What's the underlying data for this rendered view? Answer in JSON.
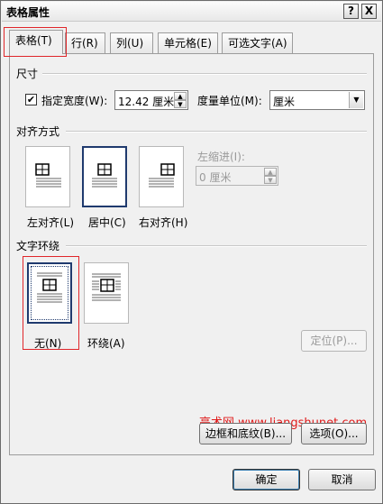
{
  "window": {
    "title": "表格属性",
    "help_label": "?",
    "close_label": "X"
  },
  "tabs": [
    {
      "label": "表格(T)"
    },
    {
      "label": "行(R)"
    },
    {
      "label": "列(U)"
    },
    {
      "label": "单元格(E)"
    },
    {
      "label": "可选文字(A)"
    }
  ],
  "size": {
    "group_title": "尺寸",
    "preferred_width_checked": true,
    "preferred_width_label": "指定宽度(W):",
    "width_value": "12.42 厘米",
    "measure_label": "度量单位(M):",
    "measure_value": "厘米"
  },
  "alignment": {
    "group_title": "对齐方式",
    "options": [
      {
        "label": "左对齐(L)"
      },
      {
        "label": "居中(C)"
      },
      {
        "label": "右对齐(H)"
      }
    ],
    "indent_label": "左缩进(I):",
    "indent_value": "0 厘米"
  },
  "wrapping": {
    "group_title": "文字环绕",
    "options": [
      {
        "label": "无(N)"
      },
      {
        "label": "环绕(A)"
      }
    ],
    "positioning_label": "定位(P)..."
  },
  "bottom_buttons": {
    "borders_label": "边框和底纹(B)...",
    "options_label": "选项(O)..."
  },
  "watermark": "亮术网 www.liangshunet.com",
  "footer": {
    "ok_label": "确定",
    "cancel_label": "取消"
  },
  "colors": {
    "highlight": "#e0262a",
    "selection": "#1f3a6e",
    "watermark": "#e01818"
  }
}
